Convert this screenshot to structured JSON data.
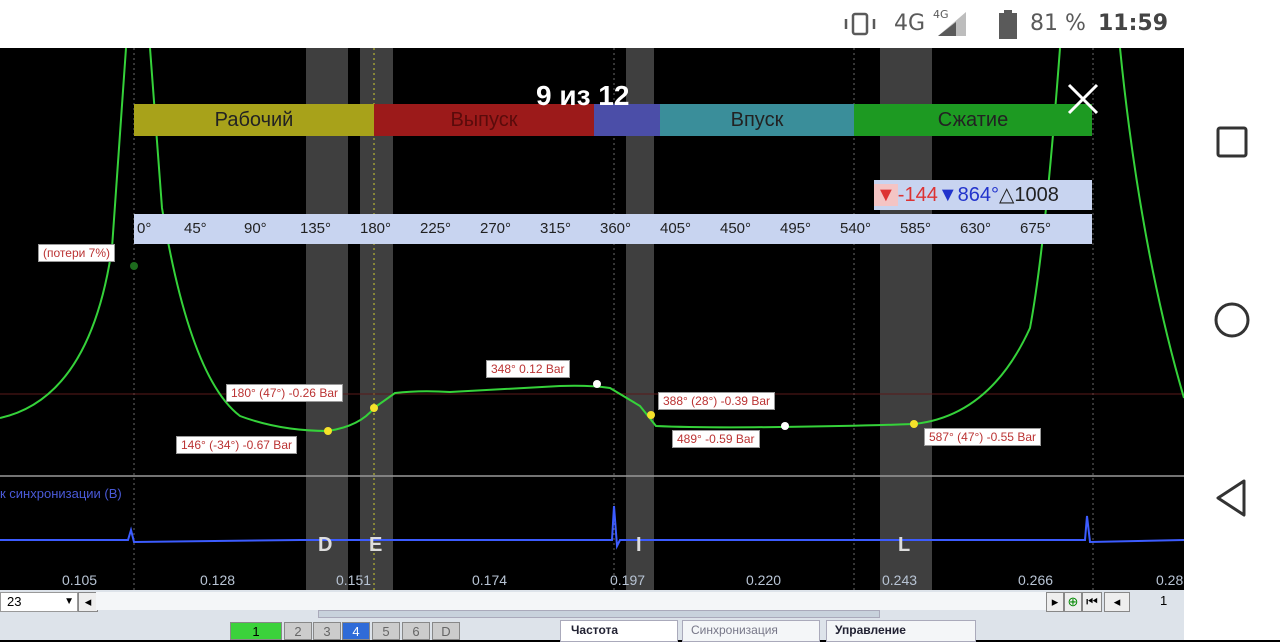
{
  "status_bar": {
    "network": "4G",
    "network_small": "4G",
    "battery": "81 %",
    "time": "11:59"
  },
  "viewer": {
    "counter": "9 из 12",
    "close_icon": "close-icon"
  },
  "phases": [
    {
      "label": "Рабочий",
      "color": "#a8a21a"
    },
    {
      "label": "Выпуск",
      "color": "#9c1a1a"
    },
    {
      "label": "Впуск",
      "color": "#3a8e9a"
    },
    {
      "label": "Сжатие",
      "color": "#1d9a22"
    }
  ],
  "markers": {
    "red_value": "-144",
    "blue_value": "864°",
    "delta_value": "1008"
  },
  "degree_scale": [
    "0°",
    "45°",
    "90°",
    "135°",
    "180°",
    "225°",
    "270°",
    "315°",
    "360°",
    "405°",
    "450°",
    "495°",
    "540°",
    "585°",
    "630°",
    "675°"
  ],
  "annotations": {
    "loss": "(потери 7%)",
    "a1": "180° (47°) -0.26 Bar",
    "a2": "146° (-34°) -0.67 Bar",
    "a3": "348° 0.12 Bar",
    "a4": "388° (28°) -0.39 Bar",
    "a5": "489° -0.59 Bar",
    "a6": "587° (47°) -0.55 Bar"
  },
  "sync_label": "к синхронизации (В)",
  "zone_letters": [
    "D",
    "E",
    "I",
    "L"
  ],
  "time_axis": [
    "0.105",
    "0.128",
    "0.151",
    "0.174",
    "0.197",
    "0.220",
    "0.243",
    "0.266",
    "0.28"
  ],
  "controls": {
    "combo_value": "23",
    "page_number": "1",
    "channel_buttons": [
      "1",
      "2",
      "3",
      "4",
      "5",
      "6",
      "D"
    ],
    "freq_label": "Частота",
    "sync_label": "Синхронизация",
    "control_label": "Управление"
  }
}
